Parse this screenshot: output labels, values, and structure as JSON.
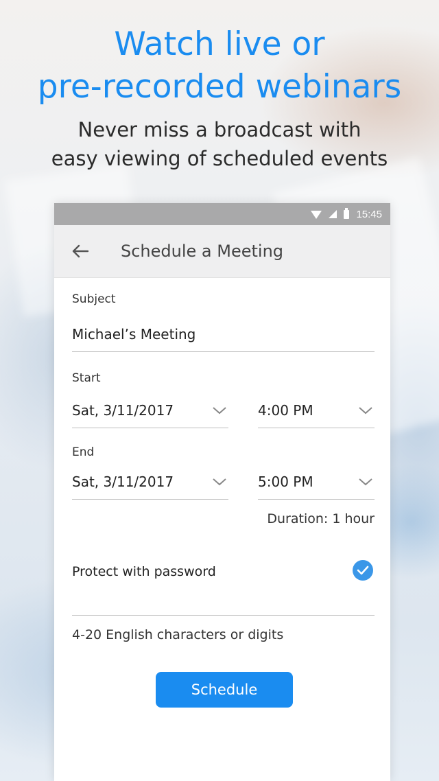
{
  "promo": {
    "headline_line1": "Watch live or",
    "headline_line2": "pre-recorded webinars",
    "subline_line1": "Never miss a broadcast with",
    "subline_line2": "easy viewing of scheduled events",
    "accent_color": "#1a8cf0"
  },
  "status_bar": {
    "time": "15:45",
    "icons": [
      "wifi-icon",
      "signal-icon",
      "battery-icon"
    ]
  },
  "app_bar": {
    "back_icon": "arrow-left-icon",
    "title": "Schedule a Meeting"
  },
  "form": {
    "subject_label": "Subject",
    "subject_value": "Michael’s Meeting",
    "start_label": "Start",
    "start_date": "Sat, 3/11/2017",
    "start_time": "4:00 PM",
    "end_label": "End",
    "end_date": "Sat, 3/11/2017",
    "end_time": "5:00 PM",
    "duration": "Duration: 1 hour",
    "password_label": "Protect with password",
    "password_checked": true,
    "password_hint": "4-20 English characters or digits",
    "schedule_button": "Schedule"
  }
}
